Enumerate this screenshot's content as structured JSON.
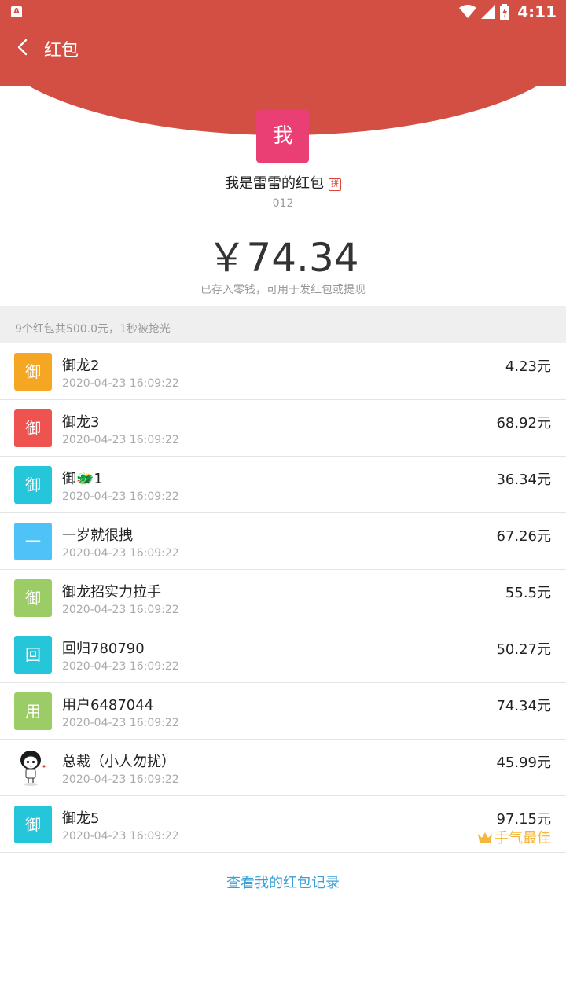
{
  "colors": {
    "header_red": "#d44f43",
    "me_avatar": "#ea3f74",
    "best_gold": "#f5b73b",
    "link_blue": "#3a9fd6"
  },
  "status_bar": {
    "app_icon_letter": "A",
    "time": "4:11",
    "icons": [
      "wifi-icon",
      "signal-icon",
      "battery-charging-icon"
    ]
  },
  "nav": {
    "back_icon": "chevron-left-icon",
    "title": "红包"
  },
  "packet": {
    "sender_avatar_char": "我",
    "sender_title": "我是雷雷的红包",
    "pin_badge": "拼",
    "blessing": "012",
    "amount": "￥74.34",
    "amount_note": "已存入零钱，可用于发红包或提现"
  },
  "summary": {
    "text": "9个红包共500.0元，1秒被抢光"
  },
  "recipients": [
    {
      "avatar_char": "御",
      "avatar_color": "#f5a623",
      "name": "御龙2",
      "time": "2020-04-23 16:09:22",
      "amount": "4.23元"
    },
    {
      "avatar_char": "御",
      "avatar_color": "#ef5350",
      "name": "御龙3",
      "time": "2020-04-23 16:09:22",
      "amount": "68.92元"
    },
    {
      "avatar_char": "御",
      "avatar_color": "#26c6da",
      "name": "御🐲1",
      "time": "2020-04-23 16:09:22",
      "amount": "36.34元"
    },
    {
      "avatar_char": "一",
      "avatar_color": "#4fc3f7",
      "name": "一岁就很拽",
      "time": "2020-04-23 16:09:22",
      "amount": "67.26元"
    },
    {
      "avatar_char": "御",
      "avatar_color": "#9ccc65",
      "name": "御龙招实力拉手",
      "time": "2020-04-23 16:09:22",
      "amount": "55.5元"
    },
    {
      "avatar_char": "回",
      "avatar_color": "#26c6da",
      "name": "回归780790",
      "time": "2020-04-23 16:09:22",
      "amount": "50.27元"
    },
    {
      "avatar_char": "用",
      "avatar_color": "#9ccc65",
      "name": "用户6487044",
      "time": "2020-04-23 16:09:22",
      "amount": "74.34元"
    },
    {
      "avatar_char": "",
      "avatar_color": "#ffffff",
      "name": "总裁（小人勿扰）",
      "time": "2020-04-23 16:09:22",
      "amount": "45.99元"
    },
    {
      "avatar_char": "御",
      "avatar_color": "#26c6da",
      "name": "御龙5",
      "time": "2020-04-23 16:09:22",
      "amount": "97.15元",
      "best_label": "手气最佳"
    }
  ],
  "footer": {
    "link_text": "查看我的红包记录"
  }
}
